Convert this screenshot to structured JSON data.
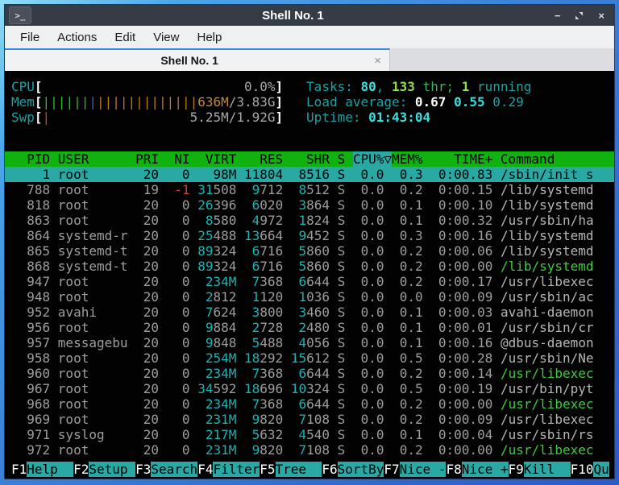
{
  "window": {
    "title": "Shell No. 1",
    "controls": {
      "minimize": "−",
      "close": "×"
    }
  },
  "menu": {
    "items": [
      "File",
      "Actions",
      "Edit",
      "View",
      "Help"
    ]
  },
  "tab": {
    "title": "Shell No. 1",
    "close": "×"
  },
  "htop": {
    "meters": {
      "bar_inner_width": 30,
      "cpu": {
        "label": "CPU",
        "value_text": "0.0%",
        "bars": []
      },
      "mem": {
        "label": "Mem",
        "used": "636M",
        "total": "3.83G",
        "bars": [
          {
            "color": "green",
            "count": 6
          },
          {
            "color": "blue",
            "count": 1
          },
          {
            "color": "orange",
            "count": 13
          }
        ]
      },
      "swp": {
        "label": "Swp",
        "used": "5.25M",
        "total": "1.92G",
        "used_color": "gray",
        "bars": [
          {
            "color": "red",
            "count": 1
          }
        ]
      }
    },
    "summary": {
      "tasks": {
        "label": "Tasks:",
        "count": "80",
        "comma": ",",
        "threads": "133",
        "thr_word": "thr;",
        "running": "1",
        "running_word": "running"
      },
      "load": {
        "label": "Load average:",
        "v1": "0.67",
        "v2": "0.55",
        "v3": "0.29"
      },
      "uptime": {
        "label": "Uptime:",
        "value": "01:43:04"
      }
    },
    "table": {
      "sort_arrow": "▽",
      "columns": [
        {
          "key": "pid",
          "label": "PID",
          "width": 5,
          "align": "right"
        },
        {
          "key": "user",
          "label": "USER",
          "width": 9,
          "align": "left"
        },
        {
          "key": "pri",
          "label": "PRI",
          "width": 3,
          "align": "right"
        },
        {
          "key": "ni",
          "label": "NI",
          "width": 3,
          "align": "right"
        },
        {
          "key": "virt",
          "label": "VIRT",
          "width": 5,
          "align": "right",
          "mem": true
        },
        {
          "key": "res",
          "label": "RES",
          "width": 5,
          "align": "right",
          "mem": true
        },
        {
          "key": "shr",
          "label": "SHR",
          "width": 5,
          "align": "right",
          "mem": true
        },
        {
          "key": "s",
          "label": "S",
          "width": 1,
          "align": "left"
        },
        {
          "key": "cpu",
          "label": "CPU%",
          "width": 4,
          "align": "right",
          "sort": true
        },
        {
          "key": "mem",
          "label": "MEM%",
          "width": 4,
          "align": "right"
        },
        {
          "key": "time",
          "label": "TIME+",
          "width": 8,
          "align": "right"
        },
        {
          "key": "command",
          "label": "Command",
          "width": 0,
          "align": "left"
        }
      ],
      "rows": [
        {
          "pid": "1",
          "user": "root",
          "pri": "20",
          "ni": "0",
          "virt": "98M",
          "res": "11804",
          "shr": "8516",
          "s": "S",
          "cpu": "0.0",
          "mem": "0.3",
          "time": "0:00.83",
          "command": "/sbin/init s",
          "selected": true
        },
        {
          "pid": "788",
          "user": "root",
          "pri": "19",
          "ni": "-1",
          "virt": "31508",
          "res": "9712",
          "shr": "8512",
          "s": "S",
          "cpu": "0.0",
          "mem": "0.2",
          "time": "0:00.15",
          "command": "/lib/systemd"
        },
        {
          "pid": "818",
          "user": "root",
          "pri": "20",
          "ni": "0",
          "virt": "26396",
          "res": "6020",
          "shr": "3864",
          "s": "S",
          "cpu": "0.0",
          "mem": "0.1",
          "time": "0:00.10",
          "command": "/lib/systemd"
        },
        {
          "pid": "863",
          "user": "root",
          "pri": "20",
          "ni": "0",
          "virt": "8580",
          "res": "4972",
          "shr": "1824",
          "s": "S",
          "cpu": "0.0",
          "mem": "0.1",
          "time": "0:00.32",
          "command": "/usr/sbin/ha"
        },
        {
          "pid": "864",
          "user": "systemd-r",
          "pri": "20",
          "ni": "0",
          "virt": "25488",
          "res": "13664",
          "shr": "9452",
          "s": "S",
          "cpu": "0.0",
          "mem": "0.3",
          "time": "0:00.16",
          "command": "/lib/systemd"
        },
        {
          "pid": "865",
          "user": "systemd-t",
          "pri": "20",
          "ni": "0",
          "virt": "89324",
          "res": "6716",
          "shr": "5860",
          "s": "S",
          "cpu": "0.0",
          "mem": "0.2",
          "time": "0:00.06",
          "command": "/lib/systemd"
        },
        {
          "pid": "868",
          "user": "systemd-t",
          "pri": "20",
          "ni": "0",
          "virt": "89324",
          "res": "6716",
          "shr": "5860",
          "s": "S",
          "cpu": "0.0",
          "mem": "0.2",
          "time": "0:00.00",
          "command": "/lib/systemd",
          "thread": true
        },
        {
          "pid": "947",
          "user": "root",
          "pri": "20",
          "ni": "0",
          "virt": "234M",
          "res": "7368",
          "shr": "6644",
          "s": "S",
          "cpu": "0.0",
          "mem": "0.2",
          "time": "0:00.17",
          "command": "/usr/libexec"
        },
        {
          "pid": "948",
          "user": "root",
          "pri": "20",
          "ni": "0",
          "virt": "2812",
          "res": "1120",
          "shr": "1036",
          "s": "S",
          "cpu": "0.0",
          "mem": "0.0",
          "time": "0:00.09",
          "command": "/usr/sbin/ac"
        },
        {
          "pid": "952",
          "user": "avahi",
          "pri": "20",
          "ni": "0",
          "virt": "7624",
          "res": "3800",
          "shr": "3460",
          "s": "S",
          "cpu": "0.0",
          "mem": "0.1",
          "time": "0:00.03",
          "command": "avahi-daemon"
        },
        {
          "pid": "956",
          "user": "root",
          "pri": "20",
          "ni": "0",
          "virt": "9884",
          "res": "2728",
          "shr": "2480",
          "s": "S",
          "cpu": "0.0",
          "mem": "0.1",
          "time": "0:00.01",
          "command": "/usr/sbin/cr"
        },
        {
          "pid": "957",
          "user": "messagebu",
          "pri": "20",
          "ni": "0",
          "virt": "9848",
          "res": "5488",
          "shr": "4056",
          "s": "S",
          "cpu": "0.0",
          "mem": "0.1",
          "time": "0:00.16",
          "command": "@dbus-daemon"
        },
        {
          "pid": "958",
          "user": "root",
          "pri": "20",
          "ni": "0",
          "virt": "254M",
          "res": "18292",
          "shr": "15612",
          "s": "S",
          "cpu": "0.0",
          "mem": "0.5",
          "time": "0:00.28",
          "command": "/usr/sbin/Ne"
        },
        {
          "pid": "960",
          "user": "root",
          "pri": "20",
          "ni": "0",
          "virt": "234M",
          "res": "7368",
          "shr": "6644",
          "s": "S",
          "cpu": "0.0",
          "mem": "0.2",
          "time": "0:00.14",
          "command": "/usr/libexec",
          "thread": true
        },
        {
          "pid": "967",
          "user": "root",
          "pri": "20",
          "ni": "0",
          "virt": "34592",
          "res": "18696",
          "shr": "10324",
          "s": "S",
          "cpu": "0.0",
          "mem": "0.5",
          "time": "0:00.19",
          "command": "/usr/bin/pyt"
        },
        {
          "pid": "968",
          "user": "root",
          "pri": "20",
          "ni": "0",
          "virt": "234M",
          "res": "7368",
          "shr": "6644",
          "s": "S",
          "cpu": "0.0",
          "mem": "0.2",
          "time": "0:00.00",
          "command": "/usr/libexec",
          "thread": true
        },
        {
          "pid": "969",
          "user": "root",
          "pri": "20",
          "ni": "0",
          "virt": "231M",
          "res": "9820",
          "shr": "7108",
          "s": "S",
          "cpu": "0.0",
          "mem": "0.2",
          "time": "0:00.09",
          "command": "/usr/libexec"
        },
        {
          "pid": "971",
          "user": "syslog",
          "pri": "20",
          "ni": "0",
          "virt": "217M",
          "res": "5632",
          "shr": "4540",
          "s": "S",
          "cpu": "0.0",
          "mem": "0.1",
          "time": "0:00.04",
          "command": "/usr/sbin/rs"
        },
        {
          "pid": "972",
          "user": "root",
          "pri": "20",
          "ni": "0",
          "virt": "231M",
          "res": "9820",
          "shr": "7108",
          "s": "S",
          "cpu": "0.0",
          "mem": "0.2",
          "time": "0:00.00",
          "command": "/usr/libexec",
          "thread": true
        }
      ]
    },
    "fkeys": [
      {
        "key": "F1",
        "label": "Help  "
      },
      {
        "key": "F2",
        "label": "Setup "
      },
      {
        "key": "F3",
        "label": "Search"
      },
      {
        "key": "F4",
        "label": "Filter"
      },
      {
        "key": "F5",
        "label": "Tree  "
      },
      {
        "key": "F6",
        "label": "SortBy"
      },
      {
        "key": "F7",
        "label": "Nice -"
      },
      {
        "key": "F8",
        "label": "Nice +"
      },
      {
        "key": "F9",
        "label": "Kill  "
      },
      {
        "key": "F10",
        "label": "Qu"
      }
    ]
  },
  "colors": {
    "header_bg": "#0fb20f",
    "selected_bg": "#2aa9a4",
    "label_teal": "#17a4a4",
    "bright_cyan": "#3cdfdf",
    "bright_green": "#94e045",
    "number_cyan": "#1bb3b3",
    "thread_green": "#3ecb3e",
    "nice_red": "#d03b3b",
    "mem_used_tan": "#c08a3e",
    "titlebar_bg": "#353c46",
    "tab_accent_blue": "#3c87e2",
    "frame_blue": "#3b82d8"
  }
}
